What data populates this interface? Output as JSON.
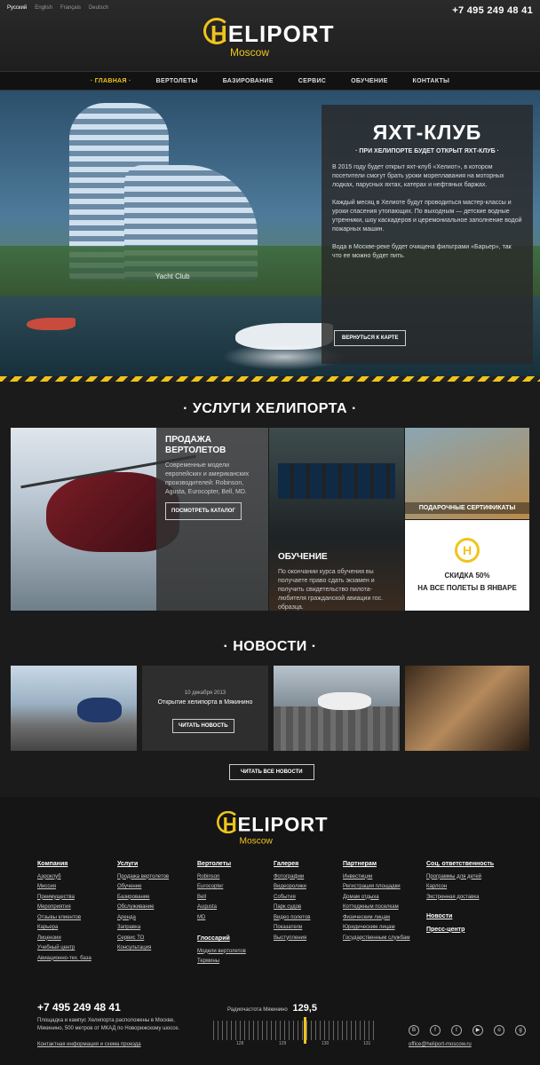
{
  "languages": [
    "Русский",
    "English",
    "Français",
    "Deutsch"
  ],
  "phone": "+7 495 249 48 41",
  "logo": {
    "word_h": "H",
    "word_rest": "ELIPORT",
    "sub": "Moscow"
  },
  "nav": [
    {
      "label": "· ГЛАВНАЯ ·",
      "active": true
    },
    {
      "label": "ВЕРТОЛЕТЫ",
      "active": false
    },
    {
      "label": "БАЗИРОВАНИЕ",
      "active": false
    },
    {
      "label": "СЕРВИС",
      "active": false
    },
    {
      "label": "ОБУЧЕНИЕ",
      "active": false
    },
    {
      "label": "КОНТАКТЫ",
      "active": false
    }
  ],
  "hero": {
    "title": "ЯХТ-КЛУБ",
    "subtitle": "· ПРИ ХЕЛИПОРТЕ БУДЕТ ОТКРЫТ ЯХТ-КЛУБ ·",
    "p1": "В 2015 году будет открыт яхт-клуб «Хелиот», в котором посетители смогут брать уроки мореплавания на моторных лодках, парусных яхтах, катерах и нефтяных баржах.",
    "p2": "Каждый месяц в Хелиоте будут проводиться мастер-классы и уроки спасения утопающих. По выходным — детские водные утренники, шоу каскадеров и церемониальное заполнение водой пожарных машин.",
    "p3": "Вода в Москве-реке будет очищена фильтрами «Барьер», так что ее можно будет пить.",
    "button": "ВЕРНУТЬСЯ К КАРТЕ",
    "building_sign": "Yacht Club"
  },
  "services": {
    "title": "· УСЛУГИ ХЕЛИПОРТА ·",
    "sale": {
      "heading": "ПРОДАЖА ВЕРТОЛЕТОВ",
      "text": "Современные модели европейских и американских производителей: Robinson, Agusta, Eurocopter, Bell, MD.",
      "button": "ПОСМОТРЕТЬ КАТАЛОГ"
    },
    "training": {
      "heading": "ОБУЧЕНИЕ",
      "text": "По окончании курса обучения вы получаете право сдать экзамен и получить свидетельство пилота-любителя гражданской авиации гос. образца."
    },
    "certificates": "ПОДАРОЧНЫЕ СЕРТИФИКАТЫ",
    "discount_line1": "СКИДКА 50%",
    "discount_line2": "НА ВСЕ ПОЛЕТЫ В ЯНВАРЕ"
  },
  "news": {
    "title": "· НОВОСТИ ·",
    "item_date": "10 декабря 2013",
    "item_title": "Открытие хелипорта в Мякинино",
    "item_button": "ЧИТАТЬ НОВОСТЬ",
    "all_button": "ЧИТАТЬ ВСЕ НОВОСТИ"
  },
  "footer": {
    "columns": [
      {
        "heading": "Компания",
        "items": [
          "Аэроклуб",
          "Миссия",
          "Преимущества",
          "Мероприятия",
          "Отзывы клиентов",
          "Карьера",
          "Лицензии",
          "Учебный центр",
          "Авиационно-тех. база"
        ]
      },
      {
        "heading": "Услуги",
        "items": [
          "Продажа вертолетов",
          "Обучение",
          "Базирование",
          "Обслуживание",
          "Аренда",
          "Заправка",
          "Сервис ТО",
          "Консультация"
        ]
      },
      {
        "heading": "Вертолеты",
        "items": [
          "Robinson",
          "Eurocopter",
          "Bell",
          "Augusta",
          "MD"
        ]
      },
      {
        "heading": "Галерея",
        "items": [
          "Фотографии",
          "Видеоролики",
          "События",
          "Парк судов",
          "Видео полетов",
          "Показатели",
          "Выступления"
        ]
      },
      {
        "heading": "Партнерам",
        "items": [
          "Инвестиции",
          "Регистрация площадки",
          "Домам отдыха",
          "Коттеджным поселкам",
          "Физическим лицам",
          "Юридическим лицам",
          "Государственным службам"
        ]
      },
      {
        "heading": "Соц. ответственность",
        "items": [
          "Программы для детей",
          "Карлсон",
          "Экстренная доставка"
        ]
      }
    ],
    "glossary": {
      "heading": "Глоссарий",
      "items": [
        "Модели вертолетов",
        "Термины"
      ]
    },
    "extra_links": [
      "Новости",
      "Пресс-центр"
    ],
    "address": "Площадка и кампус Хелипорта расположены в Москве, Мякинино, 500 метров от МКАД по Новорижскому шоссе.",
    "contact_link": "Контактная информация и схема проезда",
    "radio_label": "Радиочастота Мякинино",
    "radio_value": "129,5",
    "dial_ticks": [
      "128",
      "129",
      "130",
      "131"
    ],
    "email": "office@heliport-moscow.ru",
    "social_icons": [
      "vk-icon",
      "facebook-icon",
      "twitter-icon",
      "youtube-icon",
      "odnoklassniki-icon",
      "google-plus-icon"
    ]
  }
}
